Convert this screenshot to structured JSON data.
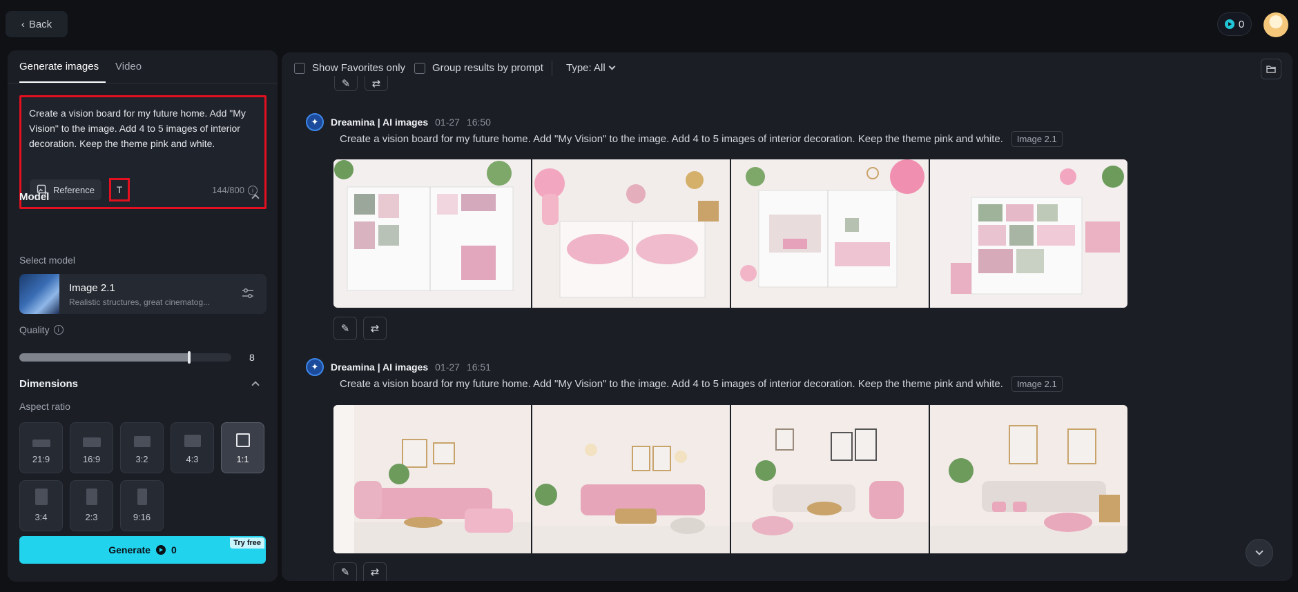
{
  "topbar": {
    "back_label": "Back",
    "credits": "0"
  },
  "left": {
    "tabs": [
      {
        "label": "Generate images"
      },
      {
        "label": "Video"
      }
    ],
    "prompt": {
      "text": "Create a vision board for my future home. Add \"My Vision\" to the image. Add 4 to 5 images of interior decoration. Keep the theme pink and white.",
      "reference_label": "Reference",
      "text_tool_glyph": "T",
      "counter": "144/800"
    },
    "model": {
      "section_title": "Model",
      "select_label": "Select model",
      "name": "Image 2.1",
      "description": "Realistic structures, great cinematog..."
    },
    "quality": {
      "label": "Quality",
      "value": "8",
      "fraction": 0.8
    },
    "dimensions": {
      "section_title": "Dimensions",
      "aspect_label": "Aspect ratio",
      "ratios": [
        "21:9",
        "16:9",
        "3:2",
        "4:3",
        "1:1",
        "3:4",
        "2:3",
        "9:16"
      ],
      "selected": "1:1"
    },
    "generate": {
      "label": "Generate",
      "credits": "0",
      "badge": "Try free"
    }
  },
  "right": {
    "filters": {
      "favorites_label": "Show Favorites only",
      "group_label": "Group results by prompt",
      "type_label": "Type: All"
    },
    "generations": [
      {
        "author": "Dreamina | AI images",
        "date": "01-27",
        "time": "16:50",
        "prompt": "Create a vision board for my future home. Add \"My Vision\" to the image. Add 4 to 5 images of interior decoration. Keep the theme pink and white.",
        "model_chip": "Image 2.1"
      },
      {
        "author": "Dreamina | AI images",
        "date": "01-27",
        "time": "16:51",
        "prompt": "Create a vision board for my future home. Add \"My Vision\" to the image. Add 4 to 5 images of interior decoration. Keep the theme pink and white.",
        "model_chip": "Image 2.1"
      }
    ]
  },
  "colors": {
    "accent": "#22d3ee",
    "highlight_border": "#e3101f",
    "panel": "#1b1e25",
    "background": "#0f1115"
  },
  "icons": [
    "chevron-left-icon",
    "coin-icon",
    "reference-image-icon",
    "text-tool-icon",
    "info-icon",
    "chevron-up-icon",
    "sliders-icon",
    "folder-icon",
    "edit-icon",
    "regenerate-icon",
    "chevron-down-icon"
  ]
}
